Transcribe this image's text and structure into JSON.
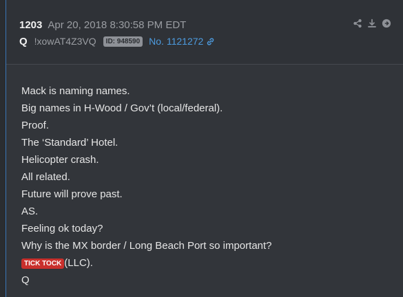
{
  "post": {
    "number": "1203",
    "timestamp": "Apr 20, 2018 8:30:58 PM EDT",
    "author": "Q",
    "tripcode": "!xowAT4Z3VQ",
    "id_badge": "ID: 948590",
    "post_no": "No. 1121272"
  },
  "icons": [
    "share-icon",
    "download-icon",
    "arrow-right-icon"
  ],
  "body": {
    "lines": [
      "Mack is naming names.",
      "Big names in H-Wood / Gov’t (local/federal).",
      "Proof.",
      "The ‘Standard’ Hotel.",
      "Helicopter crash.",
      "All related.",
      "Future will prove past.",
      "AS.",
      "Feeling ok today?",
      "Why is the MX border / Long Beach Port so important?"
    ],
    "tick_badge": "TICK TOCK",
    "tick_suffix": "(LLC).",
    "signoff": "Q"
  },
  "colors": {
    "background": "#32353a",
    "link": "#4d9ce0",
    "badge_red": "#c9302c",
    "badge_gray": "#8e9197"
  }
}
